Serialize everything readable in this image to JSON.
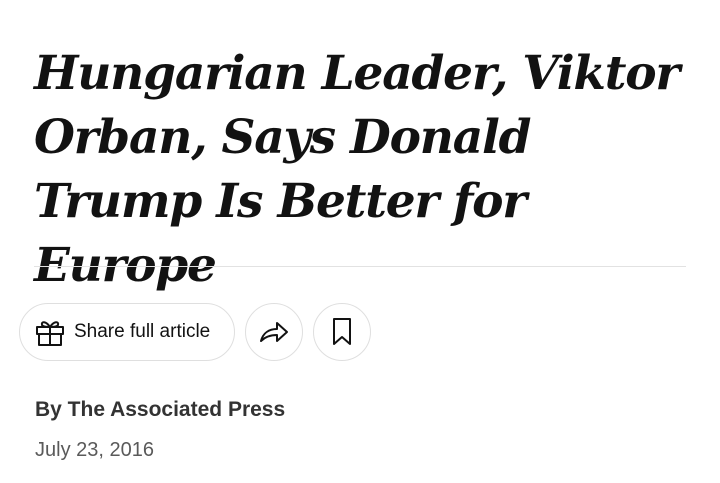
{
  "article": {
    "headline": "Hungarian Leader, Viktor Orban, Says Donald Trump Is Better for Europe",
    "byline": "By The Associated Press",
    "date": "July 23, 2016"
  },
  "actions": {
    "share_label": "Share full article",
    "gift_icon": "gift-icon",
    "share_icon": "share-arrow-icon",
    "save_icon": "bookmark-icon"
  },
  "colors": {
    "text": "#121212",
    "byline": "#333333",
    "date": "#5a5a5a",
    "border": "#dfdfdf",
    "divider": "#e2e2e2"
  }
}
